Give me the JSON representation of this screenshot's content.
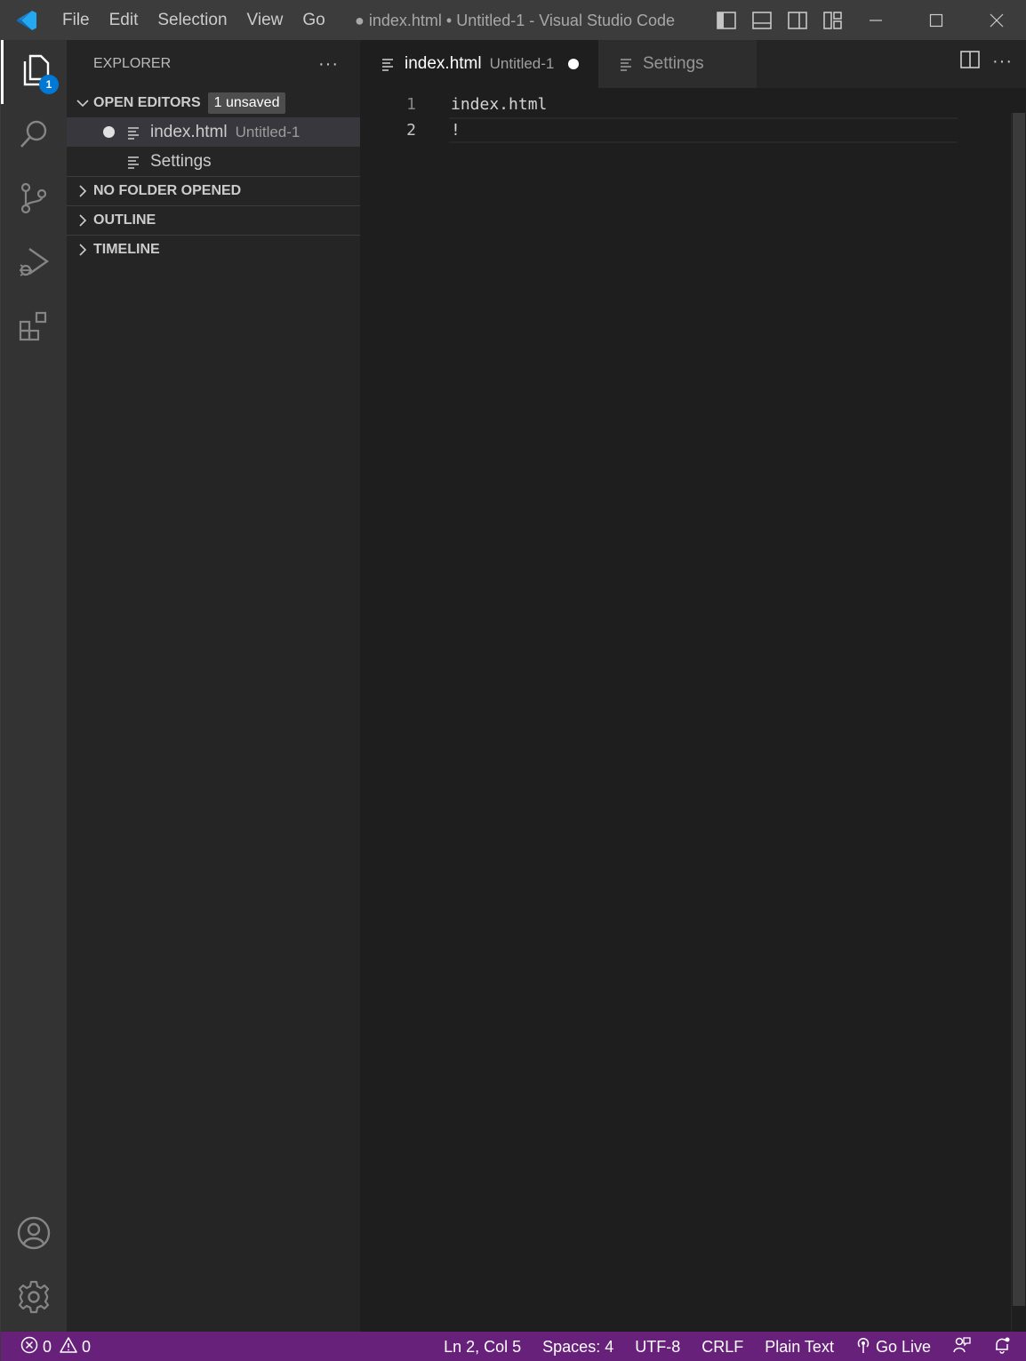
{
  "titlebar": {
    "menu": [
      "File",
      "Edit",
      "Selection",
      "View",
      "Go"
    ],
    "window_title": "● index.html • Untitled-1 - Visual Studio Code"
  },
  "activitybar": {
    "explorer_badge": "1"
  },
  "sidebar": {
    "title": "EXPLORER",
    "more": "···",
    "open_editors": {
      "label": "OPEN EDITORS",
      "badge": "1 unsaved",
      "items": [
        {
          "name": "index.html",
          "description": "Untitled-1",
          "dirty": true
        },
        {
          "name": "Settings",
          "description": "",
          "dirty": false
        }
      ]
    },
    "sections": [
      "NO FOLDER OPENED",
      "OUTLINE",
      "TIMELINE"
    ]
  },
  "editor": {
    "tabs": [
      {
        "label": "index.html",
        "description": "Untitled-1",
        "active": true,
        "dirty": true
      },
      {
        "label": "Settings",
        "description": "",
        "active": false,
        "dirty": false
      }
    ],
    "more": "···",
    "lines": [
      {
        "number": "1",
        "text": "index.html"
      },
      {
        "number": "2",
        "text": "!"
      }
    ]
  },
  "statusbar": {
    "errors": "0",
    "warnings": "0",
    "position": "Ln 2, Col 5",
    "spaces": "Spaces: 4",
    "encoding": "UTF-8",
    "eol": "CRLF",
    "language": "Plain Text",
    "golive": "Go Live"
  },
  "colors": {
    "statusbar": "#68217a",
    "badge": "#0078d4",
    "logo": "#23a9f2"
  }
}
